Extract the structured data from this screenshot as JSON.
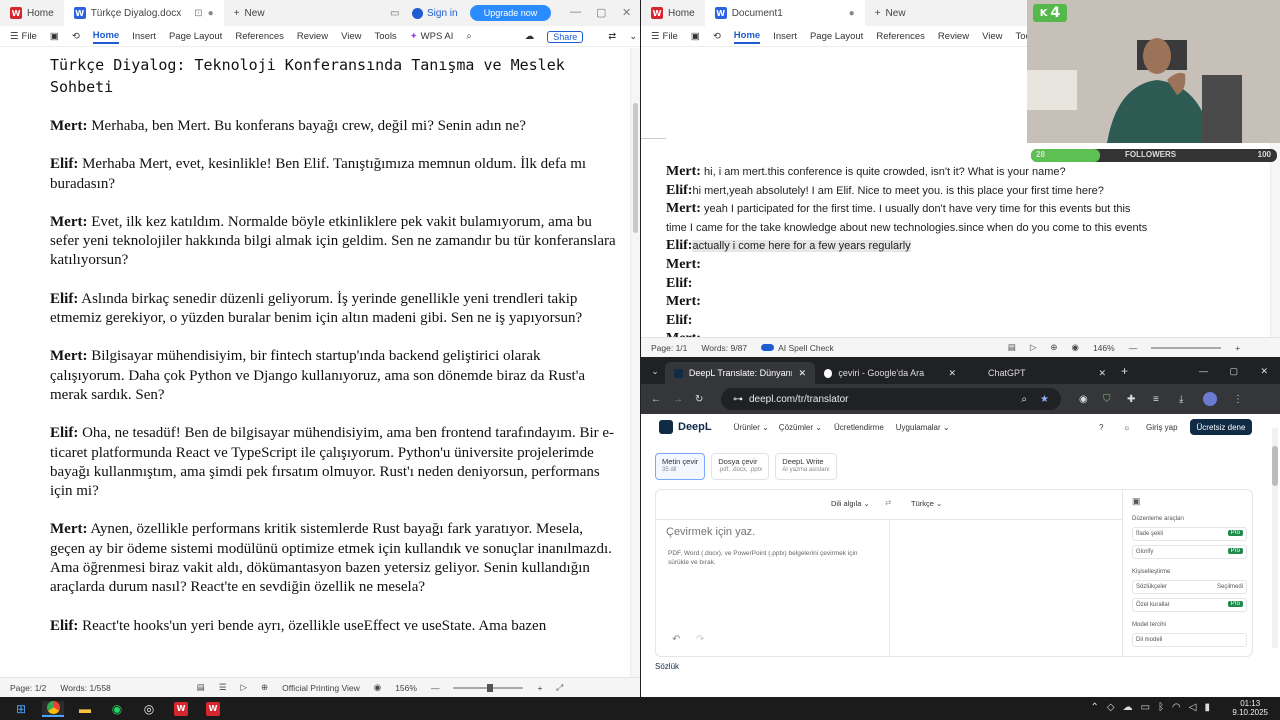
{
  "left": {
    "tabs": {
      "home": "Home",
      "doc": "Türkçe Diyalog.docx",
      "new": "New"
    },
    "sign_in": "Sign in",
    "upgrade": "Upgrade now",
    "menu": {
      "file": "File",
      "home": "Home",
      "insert": "Insert",
      "page_layout": "Page Layout",
      "references": "References",
      "review": "Review",
      "view": "View",
      "tools": "Tools",
      "wps_ai": "WPS AI",
      "share": "Share"
    },
    "title": "Türkçe Diyalog: Teknoloji Konferansında Tanışma ve Meslek Sohbeti",
    "paragraphs": [
      {
        "speaker": "Mert:",
        "text": " Merhaba, ben Mert. Bu konferans bayağı crew, değil mi? Senin adın ne?"
      },
      {
        "speaker": "Elif:",
        "text": " Merhaba Mert, evet, kesinlikle! Ben Elif. Tanıştığımıza memnun oldum. İlk defa mı buradasın?"
      },
      {
        "speaker": "Mert:",
        "text": " Evet, ilk kez katıldım. Normalde böyle etkinliklere pek vakit bulamıyorum, ama bu sefer yeni teknolojiler hakkında bilgi almak için geldim. Sen ne zamandır bu tür konferanslara katılıyorsun?"
      },
      {
        "speaker": "Elif:",
        "text": " Aslında birkaç senedir düzenli geliyorum. İş yerinde genellikle yeni trendleri takip etmemiz gerekiyor, o yüzden buralar benim için altın madeni gibi. Sen ne iş yapıyorsun?"
      },
      {
        "speaker": "Mert:",
        "text": " Bilgisayar mühendisiyim, bir fintech startup'ında backend geliştirici olarak çalışıyorum. Daha çok Python ve Django kullanıyoruz, ama son dönemde biraz da Rust'a merak sardık. Sen?"
      },
      {
        "speaker": "Elif:",
        "text": " Oha, ne tesadüf! Ben de bilgisayar mühendisiyim, ama ben frontend tarafındayım. Bir e-ticaret platformunda React ve TypeScript ile çalışıyorum. Python'u üniversite projelerimde bayağı kullanmıştım, ama şimdi pek fırsatım olmuyor. Rust'ı neden deniyorsun, performans için mi?"
      },
      {
        "speaker": "Mert:",
        "text": " Aynen, özellikle performans kritik sistemlerde Rust bayağı fark yaratıyor. Mesela, geçen ay bir ödeme sistemi modülünü optimize etmek için kullandık ve sonuçlar inanılmazdı. Ama öğrenmesi biraz vakit aldı, dökümantasyon bazen yetersiz geliyor. Senin kullandığın araçlarda durum nasıl? React'te en sevdiğin özellik ne mesela?"
      },
      {
        "speaker": "Elif:",
        "text": " React'te hooks'un yeri bende ayrı, özellikle useEffect ve useState. Ama bazen"
      }
    ],
    "status": {
      "page": "Page: 1/2",
      "words": "Words: 1/558",
      "view": "Official Printing View",
      "zoom": "156%"
    }
  },
  "right": {
    "tabs": {
      "home": "Home",
      "doc": "Document1",
      "new": "New"
    },
    "menu": {
      "file": "File",
      "home": "Home",
      "insert": "Insert",
      "page_layout": "Page Layout",
      "references": "References",
      "review": "Review",
      "view": "View",
      "tools": "Tools"
    },
    "lines": [
      {
        "speaker": "Mert:",
        "text": " hi, i am mert.this conference is quite crowded, isn't it? What is your name?"
      },
      {
        "speaker": "Elif:",
        "text": "hi mert,yeah absolutely! I am Elif. Nice to meet you. is this place your first time here?"
      },
      {
        "speaker": "Mert:",
        "text": " yeah I participated for the first time.  I usually don't have very  time for this events  but this"
      },
      {
        "speaker": "",
        "text": "time I came for the take knowledge about new technologies.since when do you come to this events"
      },
      {
        "speaker": "Elif:",
        "text": "actually i come here for a few years regularly"
      },
      {
        "speaker": "Mert:",
        "text": ""
      },
      {
        "speaker": "Elif:",
        "text": ""
      },
      {
        "speaker": "Mert:",
        "text": ""
      },
      {
        "speaker": "Elif:",
        "text": ""
      },
      {
        "speaker": "Mert:",
        "text": ""
      }
    ],
    "status": {
      "page": "Page: 1/1",
      "words": "Words: 9/87",
      "spell": "AI Spell Check",
      "zoom": "146%"
    }
  },
  "overlay": {
    "badge": "4",
    "followers_left": "28",
    "followers_label": "FOLLOWERS",
    "followers_right": "100",
    "progress": 0.28
  },
  "browser": {
    "tabs": [
      "DeepL Translate: Dünyanın en",
      "çeviri - Google'da Ara",
      "ChatGPT"
    ],
    "url": "deepl.com/tr/translator",
    "nav": {
      "brand": "DeepL",
      "products": "Ürünler",
      "solutions": "Çözümler",
      "pricing": "Ücretlendirme",
      "apps": "Uygulamalar",
      "login": "Giriş yap",
      "free": "Ücretsiz dene"
    },
    "tools": [
      {
        "label": "Metin çevir",
        "sub": "35 dil"
      },
      {
        "label": "Dosya çevir",
        "sub": ".pdf, .docx, .pptx"
      },
      {
        "label": "DeepL Write",
        "sub": "AI yazma asistanı"
      }
    ],
    "source_lang": "Dili algıla",
    "target_lang": "Türkçe",
    "placeholder": "Çevirmek için yaz.",
    "hint": "PDF, Word (.docx), ve PowerPoint (.pptx) belgelerini çevirmek için sürükle ve bırak.",
    "side": {
      "edit_title": "Düzenleme araçları",
      "edit_items": [
        "İfade şekli",
        "Glorify"
      ],
      "pro": "Pro",
      "custom_title": "Kişiselleştirme",
      "custom_items": [
        "Sözlükçeler",
        "Özel kurallar"
      ],
      "selected": "Seçilmedi",
      "model_title": "Model tercihi",
      "model_item": "Dil modeli"
    },
    "dict": "Sözlük"
  },
  "taskbar": {
    "time": "01:13",
    "date": "9.10.2025"
  }
}
